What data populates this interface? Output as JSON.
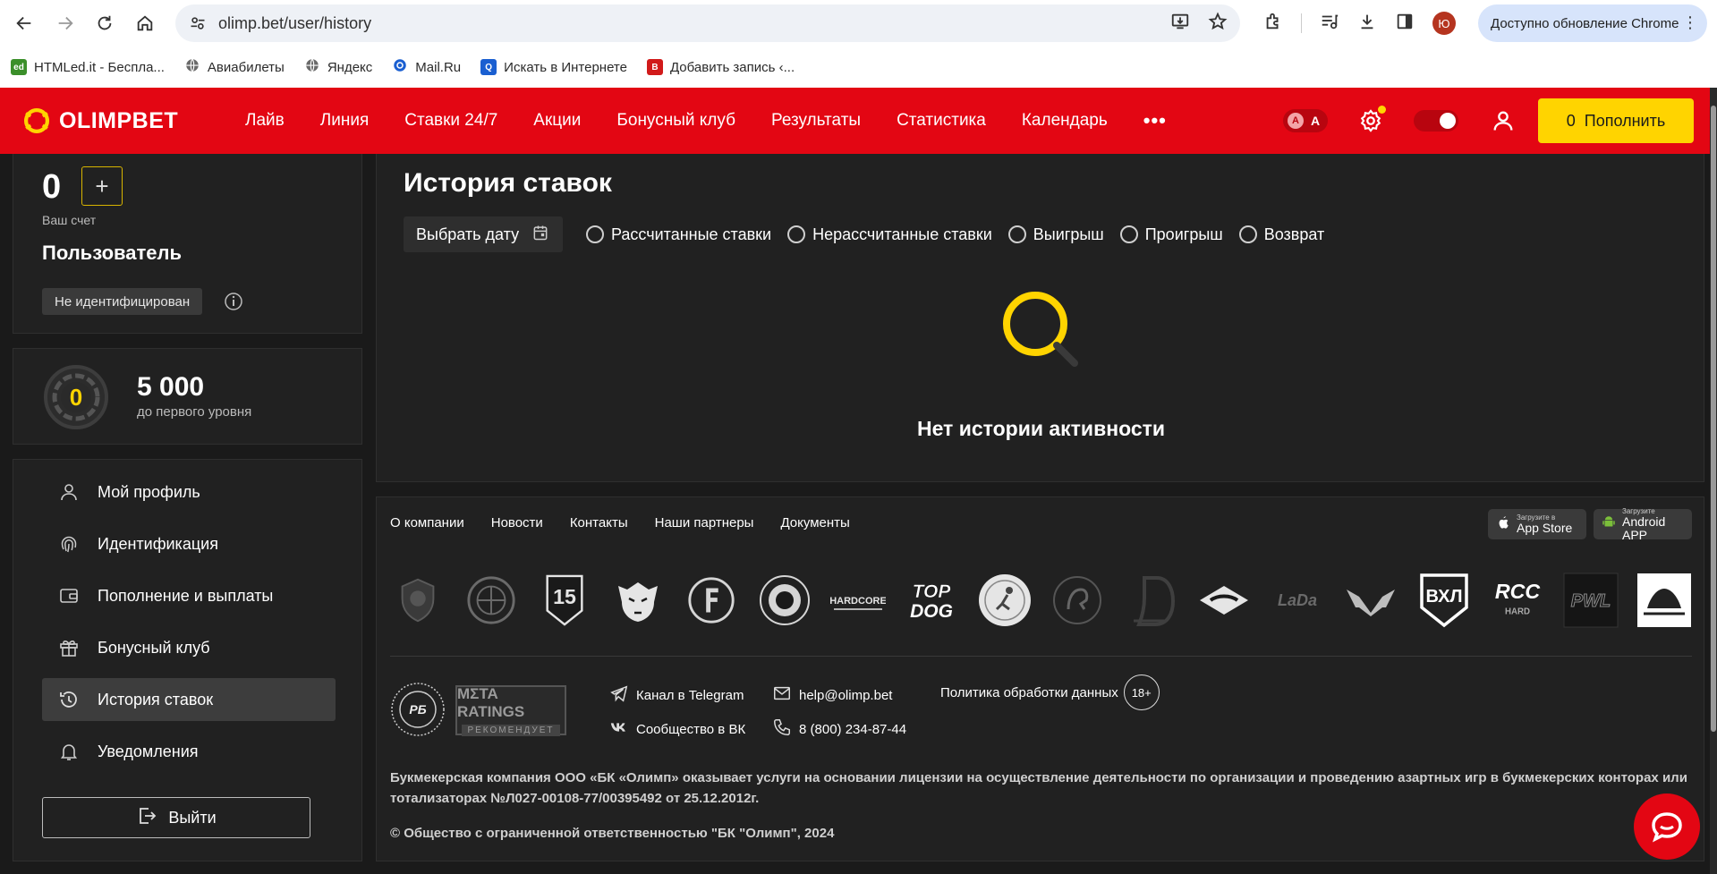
{
  "browser": {
    "url": "olimp.bet/user/history",
    "update_label": "Доступно обновление Chrome",
    "profile_initial": "Ю",
    "bookmarks": [
      {
        "label": "HTMLed.it - Беспла...",
        "icon": "htmled-icon",
        "color": "#3b8f2a"
      },
      {
        "label": "Авиабилеты",
        "icon": "globe-icon",
        "color": "#6a6a6a"
      },
      {
        "label": "Яндекс",
        "icon": "globe-icon",
        "color": "#6a6a6a"
      },
      {
        "label": "Mail.Ru",
        "icon": "mailru-icon",
        "color": "#1a5fd1"
      },
      {
        "label": "Искать в Интернете",
        "icon": "search-q-icon",
        "color": "#1a5fd1"
      },
      {
        "label": "Добавить запись ‹...",
        "icon": "b-icon",
        "color": "#d11a1a"
      }
    ]
  },
  "header": {
    "brand": "OLIMPBET",
    "nav": [
      "Лайв",
      "Линия",
      "Ставки 24/7",
      "Акции",
      "Бонусный клуб",
      "Результаты",
      "Статистика",
      "Календарь"
    ],
    "more": "•••",
    "font_switch": [
      "A",
      "A"
    ],
    "topup_amount": "0",
    "topup_label": "Пополнить",
    "colors": {
      "brand_red": "#e30613",
      "accent_yellow": "#ffd400"
    }
  },
  "account": {
    "balance": "0",
    "plus": "+",
    "balance_label": "Ваш счет",
    "user_name": "Пользователь",
    "id_status": "Не идентифицирован"
  },
  "level": {
    "level_num": "0",
    "points": "5 000",
    "points_label": "до первого уровня"
  },
  "menu": {
    "items": [
      {
        "label": "Мой профиль",
        "icon": "user-icon",
        "active": false
      },
      {
        "label": "Идентификация",
        "icon": "fingerprint-icon",
        "active": false
      },
      {
        "label": "Пополнение и выплаты",
        "icon": "wallet-icon",
        "active": false
      },
      {
        "label": "Бонусный клуб",
        "icon": "gift-icon",
        "active": false
      },
      {
        "label": "История ставок",
        "icon": "history-icon",
        "active": true
      },
      {
        "label": "Уведомления",
        "icon": "bell-icon",
        "active": false
      }
    ],
    "logout": "Выйти"
  },
  "history": {
    "title": "История ставок",
    "date_button": "Выбрать дату",
    "filters": [
      "Рассчитанные ставки",
      "Нерассчитанные ставки",
      "Выигрыш",
      "Проигрыш",
      "Возврат"
    ],
    "empty_text": "Нет истории активности"
  },
  "footer": {
    "links": [
      "О компании",
      "Новости",
      "Контакты",
      "Наши партнеры",
      "Документы"
    ],
    "app_store": {
      "small": "Загрузите в",
      "big": "App Store"
    },
    "android": {
      "small": "Загрузите",
      "big": "Android APP"
    },
    "partners": [
      "partner-crest-logo",
      "partner-basketball-league-logo",
      "partner-15-years-logo",
      "partner-tiger-logo",
      "partner-fonbet-style-logo",
      "partner-khl-club-logo",
      "partner-hardcore-logo",
      "partner-top-dog-logo",
      "partner-handball-logo",
      "partner-lion-logo",
      "partner-dynamo-logo",
      "partner-spartak-logo",
      "partner-lada-logo",
      "partner-wing-logo",
      "partner-vhl-logo",
      "partner-rcc-logo",
      "partner-pwl-logo",
      "partner-federation-logo"
    ],
    "partner_texts": {
      "hardcore": "HARDCORE",
      "topdog_1": "TOP",
      "topdog_2": "DOG",
      "lada": "LaDa",
      "vhl": "ВХЛ",
      "rcc": "RCC",
      "rcc_sub": "HARD",
      "pwl": "PWL",
      "num15": "15"
    },
    "rb_badge": "РБ",
    "meta_ratings": {
      "top": "MΣTA RATINGS",
      "bottom": "РЕКОМЕНДУЕТ"
    },
    "telegram": "Канал в Telegram",
    "vk": "Сообщество в ВК",
    "email": "help@olimp.bet",
    "phone": "8 (800) 234-87-44",
    "privacy": "Политика обработки данных",
    "age": "18+",
    "legal": "Букмекерская компания ООО «БК «Олимп» оказывает услуги на основании лицензии на осуществление деятельности по организации и проведению азартных игр в букмекерских конторах или тотализаторах №Л027-00108-77/00395492 от 25.12.2012г.",
    "copyright": "© Общество с ограниченной ответственностью \"БК \"Олимп\", 2024"
  }
}
